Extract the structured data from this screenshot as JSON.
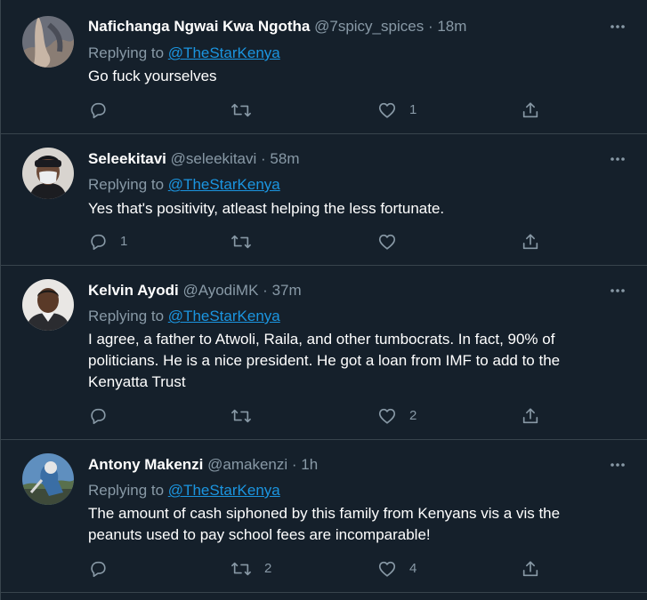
{
  "colors": {
    "background": "#15202b",
    "border": "#38444d",
    "text_primary": "#ffffff",
    "text_secondary": "#8899a6",
    "link": "#1b95e0"
  },
  "replying_label": "Replying to",
  "dot": "·",
  "icons": {
    "reply": "reply-icon",
    "retweet": "retweet-icon",
    "like": "like-icon",
    "share": "share-icon",
    "more": "more-icon"
  },
  "tweets": [
    {
      "name": "Nafichanga Ngwai Kwa Ngotha",
      "handle": "@7spicy_spices",
      "time": "18m",
      "reply_to": "@TheStarKenya",
      "text": "Go fuck yourselves",
      "replies": "",
      "retweets": "",
      "likes": "1"
    },
    {
      "name": "Seleekitavi",
      "handle": "@seleekitavi",
      "time": "58m",
      "reply_to": "@TheStarKenya",
      "text": "Yes that's positivity, atleast helping the less fortunate.",
      "replies": "1",
      "retweets": "",
      "likes": ""
    },
    {
      "name": "Kelvin Ayodi",
      "handle": "@AyodiMK",
      "time": "37m",
      "reply_to": "@TheStarKenya",
      "text_lines": [
        "I agree, a father to Atwoli, Raila, and other tumbocrats. In fact, 90% of",
        "politicians. He is a nice president. He got a loan from IMF to add to the",
        "Kenyatta Trust"
      ],
      "replies": "",
      "retweets": "",
      "likes": "2"
    },
    {
      "name": "Antony Makenzi",
      "handle": "@amakenzi",
      "time": "1h",
      "reply_to": "@TheStarKenya",
      "text_lines": [
        "The amount of cash siphoned by this family from Kenyans vis a vis the",
        "peanuts used to pay school fees are incomparable!"
      ],
      "replies": "",
      "retweets": "2",
      "likes": "4"
    }
  ]
}
